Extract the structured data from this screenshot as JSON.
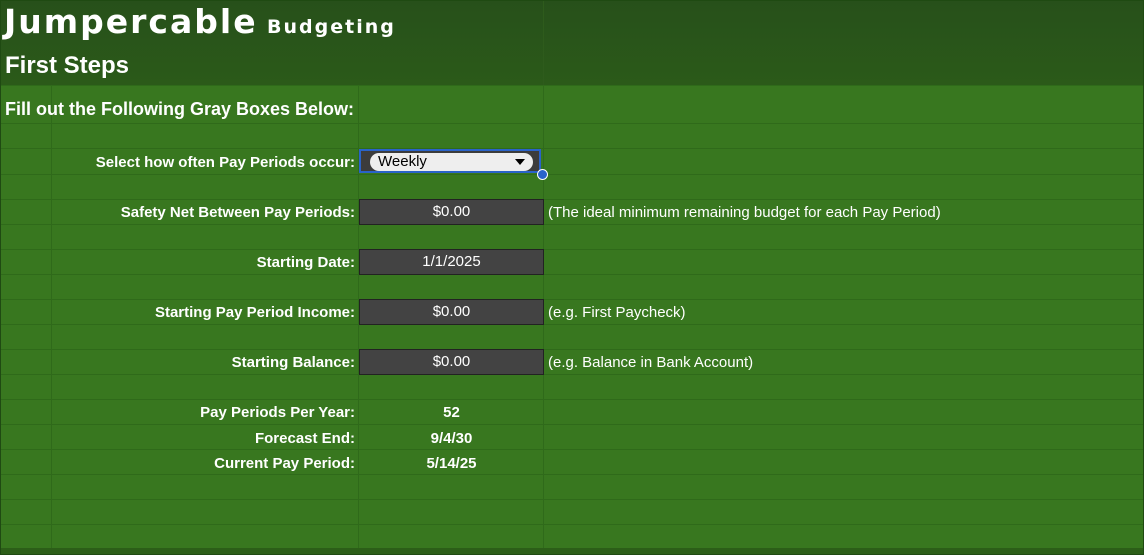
{
  "brand": {
    "name": "Jumpercable",
    "product": "Budgeting"
  },
  "page": {
    "title": "First Steps",
    "instruction": "Fill out the Following Gray Boxes Below:"
  },
  "fields": {
    "pay_frequency": {
      "label": "Select how often Pay Periods occur:",
      "value": "Weekly"
    },
    "safety_net": {
      "label": "Safety Net Between Pay Periods:",
      "value": "$0.00",
      "note": "(The ideal minimum remaining budget for each Pay Period)"
    },
    "starting_date": {
      "label": "Starting Date:",
      "value": "1/1/2025"
    },
    "starting_income": {
      "label": "Starting Pay Period Income:",
      "value": "$0.00",
      "note": "(e.g. First Paycheck)"
    },
    "starting_balance": {
      "label": "Starting Balance:",
      "value": "$0.00",
      "note": "(e.g. Balance in Bank Account)"
    }
  },
  "summary": {
    "pay_periods_per_year": {
      "label": "Pay Periods Per Year:",
      "value": "52"
    },
    "forecast_end": {
      "label": "Forecast End:",
      "value": "9/4/30"
    },
    "current_pay_period": {
      "label": "Current Pay Period:",
      "value": "5/14/25"
    }
  },
  "colors": {
    "background": "#38771f",
    "header": "#27501a",
    "input_box": "#434343",
    "selection": "#2a63c9"
  }
}
